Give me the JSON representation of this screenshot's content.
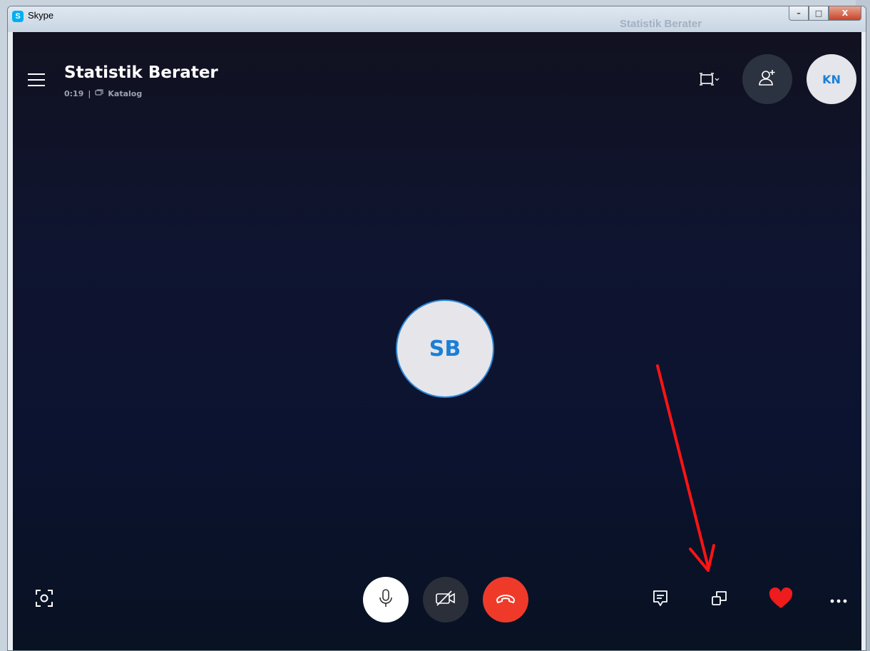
{
  "window": {
    "title": "Skype",
    "app_icon": "S",
    "background_title": "Statistik Berater",
    "buttons": {
      "minimize": "–",
      "maximize": "□",
      "close": "X"
    }
  },
  "call": {
    "title": "Statistik Berater",
    "duration": "0:19",
    "separator": "|",
    "group": "Katalog",
    "self_avatar_initials": "KN",
    "participant_initials": "SB"
  },
  "icons": {
    "menu": "hamburger-icon",
    "view": "view-layout-icon",
    "add_person": "add-person-icon",
    "snapshot": "snapshot-icon",
    "mic": "microphone-icon",
    "camera": "camera-off-icon",
    "hangup": "hang-up-icon",
    "chat": "chat-icon",
    "switch": "switch-window-icon",
    "react": "heart-icon",
    "more": "more-options-icon"
  },
  "colors": {
    "accent": "#1c7fd6",
    "hangup": "#ef3a2a",
    "heart": "#ee1c1c",
    "annotation_arrow": "#ff1414"
  }
}
